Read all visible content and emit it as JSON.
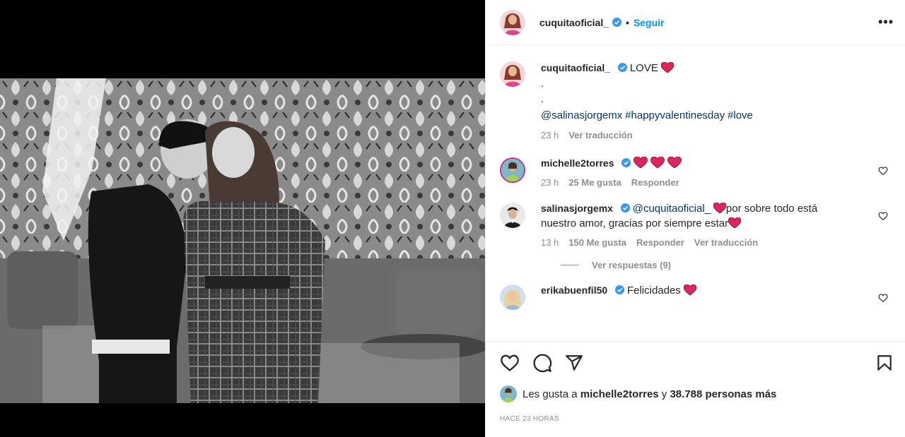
{
  "post": {
    "author": "cuquitaoficial_",
    "dot": "•",
    "follow_label": "Seguir",
    "more_label": "•••"
  },
  "caption": {
    "user": "cuquitaoficial_",
    "text": "LOVE",
    "line2": ".",
    "line3": ".",
    "mention": "@salinasjorgemx",
    "hashtag1": "#happyvalentinesday",
    "hashtag2": "#love",
    "time": "23 h",
    "translate": "Ver traducción"
  },
  "comments": [
    {
      "user": "michelle2torres",
      "time": "23 h",
      "likes": "25 Me gusta",
      "reply": "Responder"
    },
    {
      "user": "salinasjorgemx",
      "mention": "@cuquitaoficial_",
      "text1": "por sobre todo está",
      "text2": "nuestro amor, gracias por siempre estar",
      "time": "13 h",
      "likes": "150 Me gusta",
      "reply": "Responder",
      "translate": "Ver traducción",
      "view_replies": "Ver respuestas (9)"
    },
    {
      "user": "erikabuenfil50",
      "text": "Felicidades"
    }
  ],
  "likes": {
    "prefix": "Les gusta a",
    "user": "michelle2torres",
    "joiner": "y",
    "count": "38.788 personas más"
  },
  "posted_ago": "HACE 23 HORAS",
  "colors": {
    "accent": "#0095f6",
    "verified": "#3897f0",
    "heart": "#e0245e",
    "link": "#00376b",
    "muted": "#8e8e8e"
  },
  "icons": {
    "like": "heart-icon",
    "comment": "comment-icon",
    "share": "share-icon",
    "save": "bookmark-icon"
  }
}
